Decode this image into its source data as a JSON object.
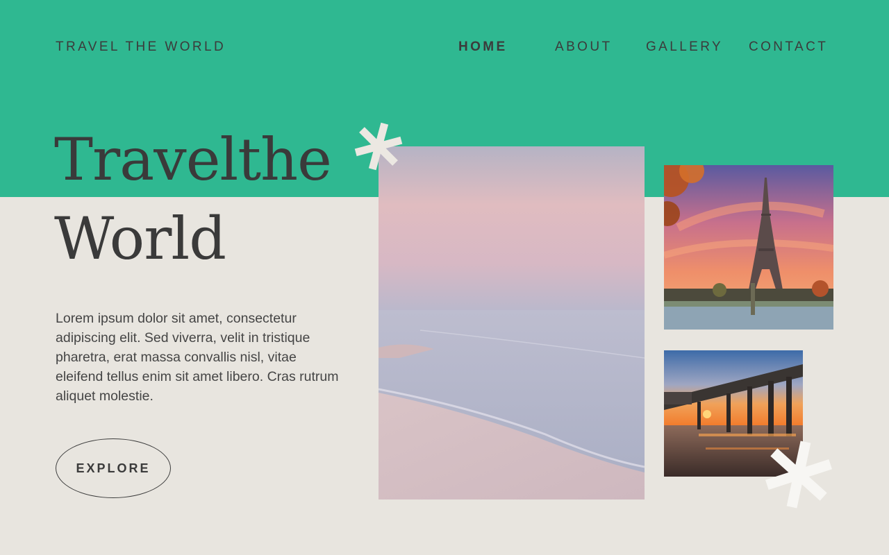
{
  "header": {
    "brand": "TRAVEL THE WORLD",
    "nav": [
      {
        "label": "HOME",
        "active": true
      },
      {
        "label": "ABOUT",
        "active": false
      },
      {
        "label": "GALLERY",
        "active": false
      },
      {
        "label": "CONTACT",
        "active": false
      }
    ]
  },
  "hero": {
    "headline_line1": "Travelthe",
    "headline_line2": "World",
    "body": "Lorem ipsum dolor sit amet, consectetur adipiscing elit. Sed viverra, velit in tristique pharetra, erat massa convallis nisl, vitae eleifend tellus enim sit amet libero. Cras rutrum aliquet molestie.",
    "cta_label": "EXPLORE"
  },
  "colors": {
    "accent": "#2fb891",
    "background": "#e8e5df",
    "text": "#3a3a3a"
  },
  "images": [
    {
      "name": "beach-photo",
      "subject": "pastel beach at dawn"
    },
    {
      "name": "eiffel-tower-photo",
      "subject": "Eiffel Tower at sunset"
    },
    {
      "name": "pier-photo",
      "subject": "pier at sunset"
    }
  ],
  "decorations": [
    "asterisk-icon",
    "asterisk-icon"
  ]
}
